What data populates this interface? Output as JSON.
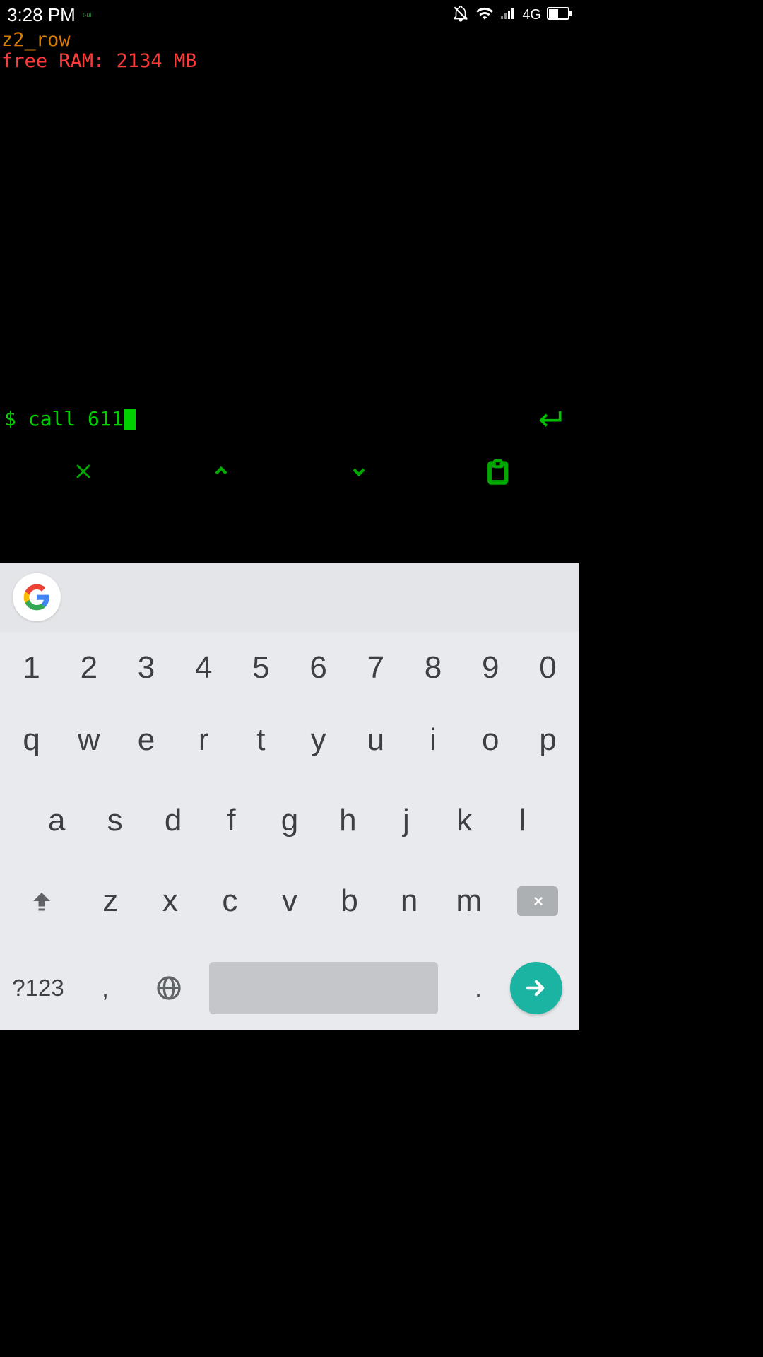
{
  "status": {
    "time": "3:28 PM",
    "mini": "t-ui",
    "network": "4G"
  },
  "terminal": {
    "line1": "z2_row",
    "line2": "free RAM: 2134 MB",
    "prompt": "$",
    "command": "call 611"
  },
  "keyboard": {
    "row1": [
      "1",
      "2",
      "3",
      "4",
      "5",
      "6",
      "7",
      "8",
      "9",
      "0"
    ],
    "row2": [
      "q",
      "w",
      "e",
      "r",
      "t",
      "y",
      "u",
      "i",
      "o",
      "p"
    ],
    "row3": [
      "a",
      "s",
      "d",
      "f",
      "g",
      "h",
      "j",
      "k",
      "l"
    ],
    "row4": [
      "z",
      "x",
      "c",
      "v",
      "b",
      "n",
      "m"
    ],
    "special": {
      "symbols": "?123",
      "comma": ",",
      "dot": "."
    }
  }
}
